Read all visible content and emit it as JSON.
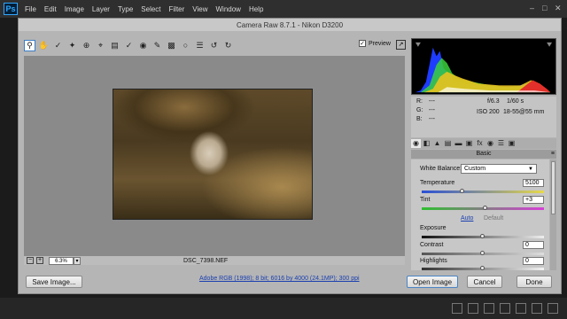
{
  "app": {
    "logo": "Ps",
    "menu": [
      "File",
      "Edit",
      "Image",
      "Layer",
      "Type",
      "Select",
      "Filter",
      "View",
      "Window",
      "Help"
    ]
  },
  "dialog": {
    "title": "Camera Raw 8.7.1  -  Nikon D3200",
    "preview_label": "Preview",
    "tools": [
      "zoom-icon",
      "hand-icon",
      "white-balance-icon",
      "color-sampler-icon",
      "target-adjust-icon",
      "crop-icon",
      "straighten-icon",
      "spot-removal-icon",
      "red-eye-icon",
      "adjustment-brush-icon",
      "graduated-filter-icon",
      "radial-filter-icon",
      "preferences-icon",
      "rotate-ccw-icon",
      "rotate-cw-icon"
    ],
    "zoom_value": "6.3%",
    "filename": "DSC_7398.NEF",
    "workflow_link": "Adobe RGB (1998); 8 bit; 6016 by 4000 (24.1MP); 300 ppi",
    "buttons": {
      "save": "Save Image...",
      "open": "Open Image",
      "cancel": "Cancel",
      "done": "Done"
    }
  },
  "info": {
    "r_label": "R:",
    "g_label": "G:",
    "b_label": "B:",
    "r_value": "---",
    "g_value": "---",
    "b_value": "---",
    "aperture": "f/6.3",
    "shutter": "1/60 s",
    "iso": "ISO 200",
    "lens": "18-55@55 mm"
  },
  "panel": {
    "section_title": "Basic",
    "white_balance_label": "White Balance:",
    "white_balance_value": "Custom",
    "auto_link": "Auto",
    "default_link": "Default",
    "sliders": [
      {
        "label": "Temperature",
        "value": "5100",
        "level": 0.33
      },
      {
        "label": "Tint",
        "value": "+3",
        "level": 0.52
      },
      {
        "label": "Exposure",
        "value": "",
        "level": 0.5
      },
      {
        "label": "Contrast",
        "value": "0",
        "level": 0.5
      },
      {
        "label": "Highlights",
        "value": "0",
        "level": 0.5
      }
    ]
  },
  "colors": {
    "accent": "#3b7cc4",
    "link": "#1a3fb0",
    "dialog_bg": "#b5b5b5"
  }
}
